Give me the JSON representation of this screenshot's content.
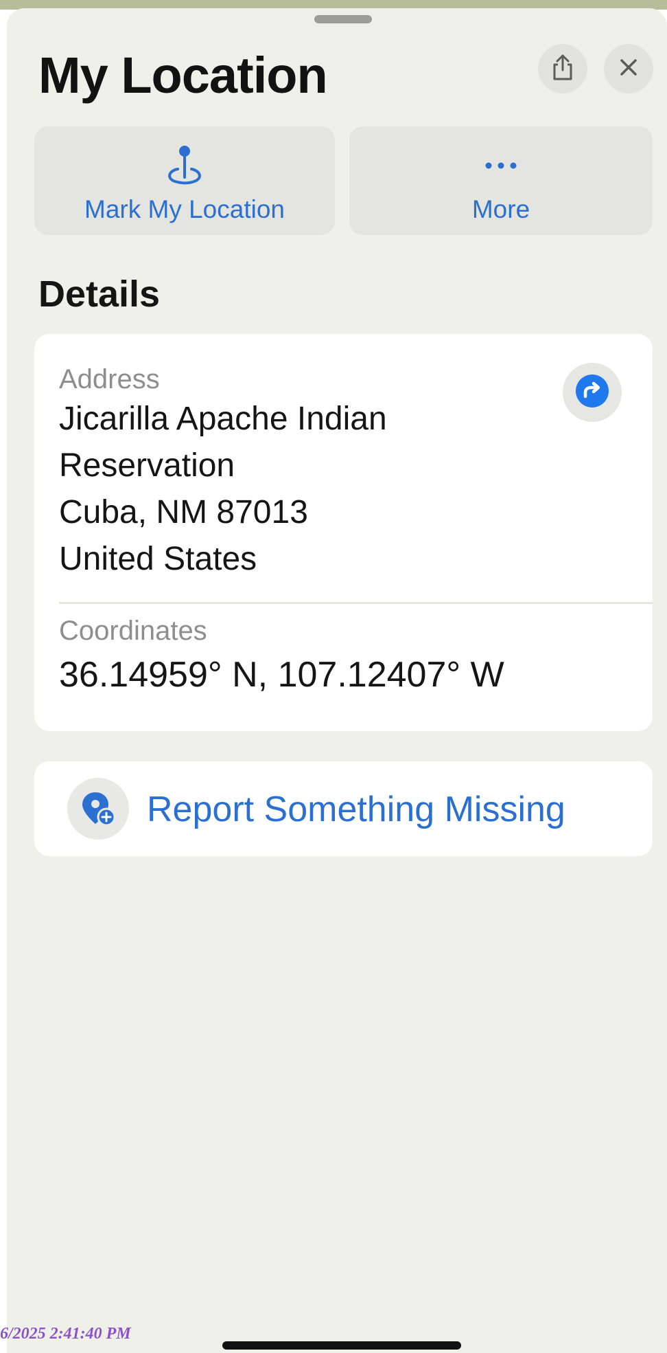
{
  "sheet": {
    "title": "My Location",
    "share_icon": "share-icon",
    "close_icon": "close-icon"
  },
  "actions": [
    {
      "label": "Mark My Location",
      "icon": "map-pin-icon"
    },
    {
      "label": "More",
      "icon": "ellipsis-icon"
    }
  ],
  "details": {
    "title": "Details",
    "address": {
      "label": "Address",
      "lines": [
        "Jicarilla Apache Indian",
        "Reservation",
        "Cuba, NM  87013",
        "United States"
      ],
      "directions_icon": "directions-icon"
    },
    "coordinates": {
      "label": "Coordinates",
      "value": "36.14959° N, 107.12407° W"
    }
  },
  "report": {
    "label": "Report Something Missing",
    "icon": "report-location-icon"
  },
  "timestamp": "6/2025 2:41:40 PM",
  "colors": {
    "accent": "#2b6fd1",
    "sheet_background": "#f0f0ea",
    "map_strip": "#b7bd98"
  }
}
